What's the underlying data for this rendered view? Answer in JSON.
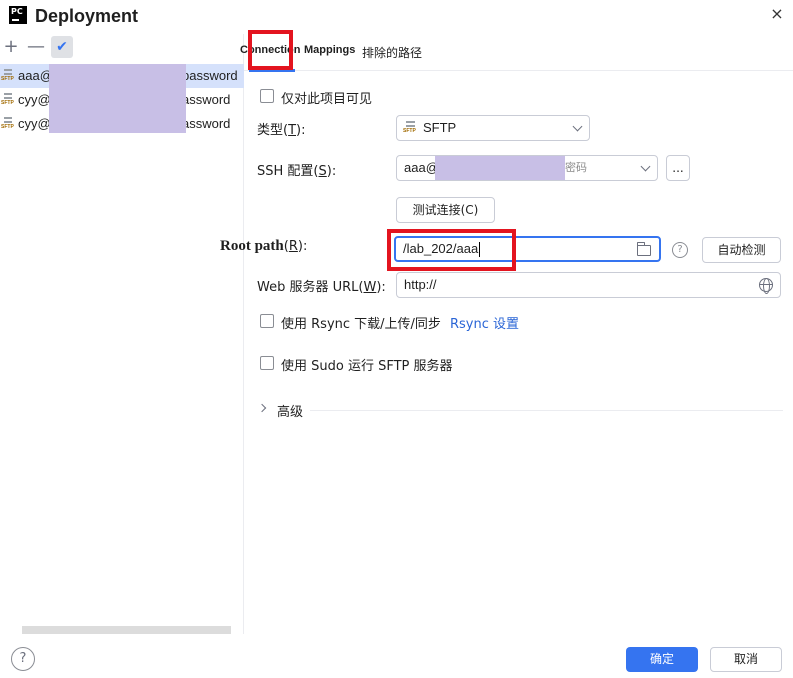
{
  "window": {
    "app_logo_text": "PC",
    "title": "Deployment",
    "close_glyph": "×"
  },
  "left_panel": {
    "toolbar": {
      "add_glyph": "+",
      "remove_glyph": "—",
      "check_glyph": "✔"
    },
    "servers": [
      {
        "prefix": "aaa@",
        "suffix": "password",
        "icon": "sftp-icon"
      },
      {
        "prefix": "cyy@",
        "suffix": "assword",
        "icon": "sftp-icon"
      },
      {
        "prefix": "cyy@",
        "suffix": "assword",
        "icon": "sftp-icon"
      }
    ],
    "sftp_icon_text": "SFTP"
  },
  "tabs": {
    "connection": "Connection",
    "mappings": "Mappings",
    "excluded": "排除的路径"
  },
  "form": {
    "visible_only_label": "仅对此项目可见",
    "type_label_pre": "类型(",
    "type_label_mn": "T",
    "type_label_post": "):",
    "type_value": "SFTP",
    "ssh_label_pre": "SSH 配置(",
    "ssh_label_mn": "S",
    "ssh_label_post": "):",
    "ssh_value_prefix": "aaa@",
    "ssh_value_suffix": "密码",
    "ssh_more": "...",
    "test_connection": "测试连接(C)",
    "root_path_label": "Root path",
    "root_path_mn_pre": "(",
    "root_path_mn": "R",
    "root_path_mn_post": "):",
    "root_path_value": "/lab_202/aaa",
    "help_glyph": "?",
    "autodetect": "自动检测",
    "web_url_label_pre": "Web 服务器 URL(",
    "web_url_label_mn": "W",
    "web_url_label_post": "):",
    "web_url_value": "http://",
    "rsync_label": "使用 Rsync 下载/上传/同步",
    "rsync_link": "Rsync 设置",
    "sudo_label": "使用 Sudo 运行 SFTP 服务器",
    "advanced_label": "高级"
  },
  "footer": {
    "help_glyph": "?",
    "ok": "确定",
    "cancel": "取消"
  },
  "colors": {
    "accent": "#3574f0",
    "highlight_box": "#e3141f",
    "redaction": "#c8bfe6",
    "selected_row": "#d5e1fb"
  }
}
